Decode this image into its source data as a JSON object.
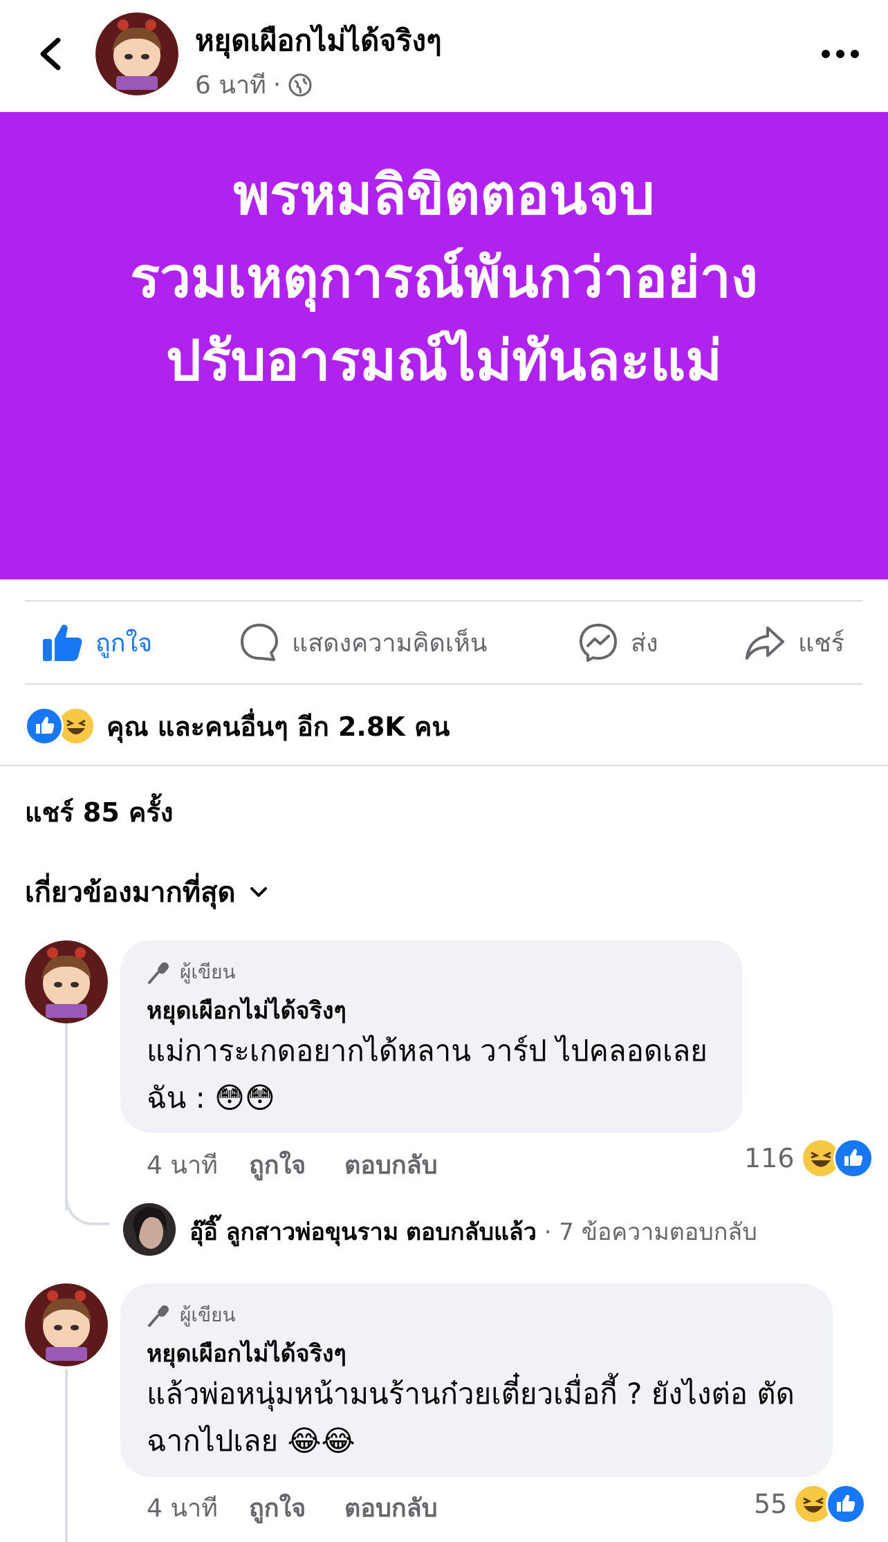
{
  "header": {
    "page_name": "หยุดเผือกไม่ได้จริงๆ",
    "time": "6 นาที",
    "separator": "·",
    "privacy_icon": "globe-icon",
    "back_icon": "chevron-left-icon",
    "more_icon": "more-horizontal-icon"
  },
  "post": {
    "background_color": "#b023ee",
    "lines": [
      "พรหมลิขิตตอนจบ",
      "รวมเหตุการณ์พันกว่าอย่าง",
      "ปรับอารมณ์ไม่ทันละแม่"
    ]
  },
  "actions": {
    "like": "ถูกใจ",
    "comment": "แสดงความคิดเห็น",
    "send": "ส่ง",
    "share": "แชร์"
  },
  "reactions": {
    "summary": "คุณ และคนอื่นๆ อีก 2.8K คน"
  },
  "shares": "แชร์ 85 ครั้ง",
  "sort": {
    "label": "เกี่ยวข้องมากที่สุด"
  },
  "comments": [
    {
      "badge": "ผู้เขียน",
      "name": "หยุดเผือกไม่ได้จริงๆ",
      "text_lines": [
        "แม่การะเกดอยากได้หลาน วาร์ป ไปคลอดเลย",
        "ฉัน : 😳😳"
      ],
      "time": "4 นาที",
      "like": "ถูกใจ",
      "reply": "ตอบกลับ",
      "reaction_count": "116"
    },
    {
      "badge": "ผู้เขียน",
      "name": "หยุดเผือกไม่ได้จริงๆ",
      "text_lines": [
        "แล้วพ่อหนุ่มหน้ามนร้านก๋วยเตี๋ยวเมื่อกี้ ? ยังไงต่อ ตัด",
        "ฉากไปเลย 😂😂"
      ],
      "time": "4 นาที",
      "like": "ถูกใจ",
      "reply": "ตอบกลับ",
      "reaction_count": "55"
    }
  ],
  "reply_summary": {
    "name": "อุ๊อิ๊ ลูกสาวพ่อขุนราม",
    "action": "ตอบกลับแล้ว",
    "count": "· 7 ข้อความตอบกลับ"
  },
  "colors": {
    "accent": "#1877f2",
    "secondary_text": "#65676b",
    "bubble": "#f0f2f5"
  }
}
